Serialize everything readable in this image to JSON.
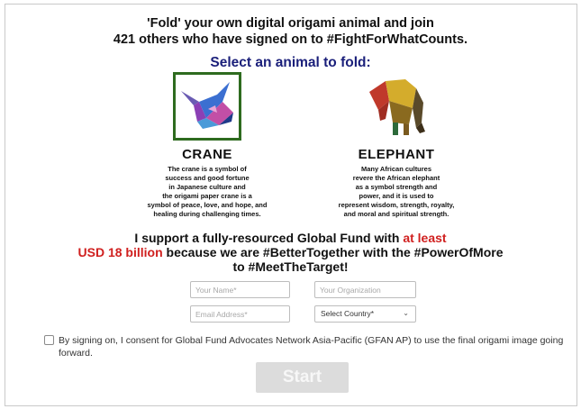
{
  "header": {
    "line1": "'Fold' your own digital origami animal and join",
    "line2": "421 others who have signed on to #FightForWhatCounts.",
    "select_prompt": "Select an animal to fold:"
  },
  "animals": [
    {
      "name": "CRANE",
      "selected": true,
      "description": "The crane is a symbol of\nsuccess and good fortune\nin Japanese culture and\nthe origami paper crane is a\nsymbol of peace, love, and hope, and\nhealing during challenging times."
    },
    {
      "name": "ELEPHANT",
      "selected": false,
      "description": "Many African cultures\nrevere the African elephant\nas a symbol strength and\npower, and it is used to\nrepresent wisdom, strength, royalty,\nand moral and spiritual strength."
    }
  ],
  "support": {
    "part1": "I support a fully-resourced Global Fund with ",
    "highlight1": "at least",
    "highlight2": "USD 18 billion",
    "part2": " because we are #BetterTogether with the #PowerOfMore",
    "part3": "to #MeetTheTarget!"
  },
  "form": {
    "name_placeholder": "Your Name*",
    "org_placeholder": "Your Organization",
    "email_placeholder": "Email Address*",
    "country_selected": "Select Country*"
  },
  "consent": {
    "checked": false,
    "text": "By signing on, I consent for Global Fund Advocates Network Asia-Pacific (GFAN AP) to use the final origami image going forward."
  },
  "start_label": "Start",
  "colors": {
    "accent_red": "#d0201f",
    "prompt_blue": "#1a1f7a",
    "selection_green": "#2e6b1f",
    "button_disabled": "#dcdcdc"
  }
}
